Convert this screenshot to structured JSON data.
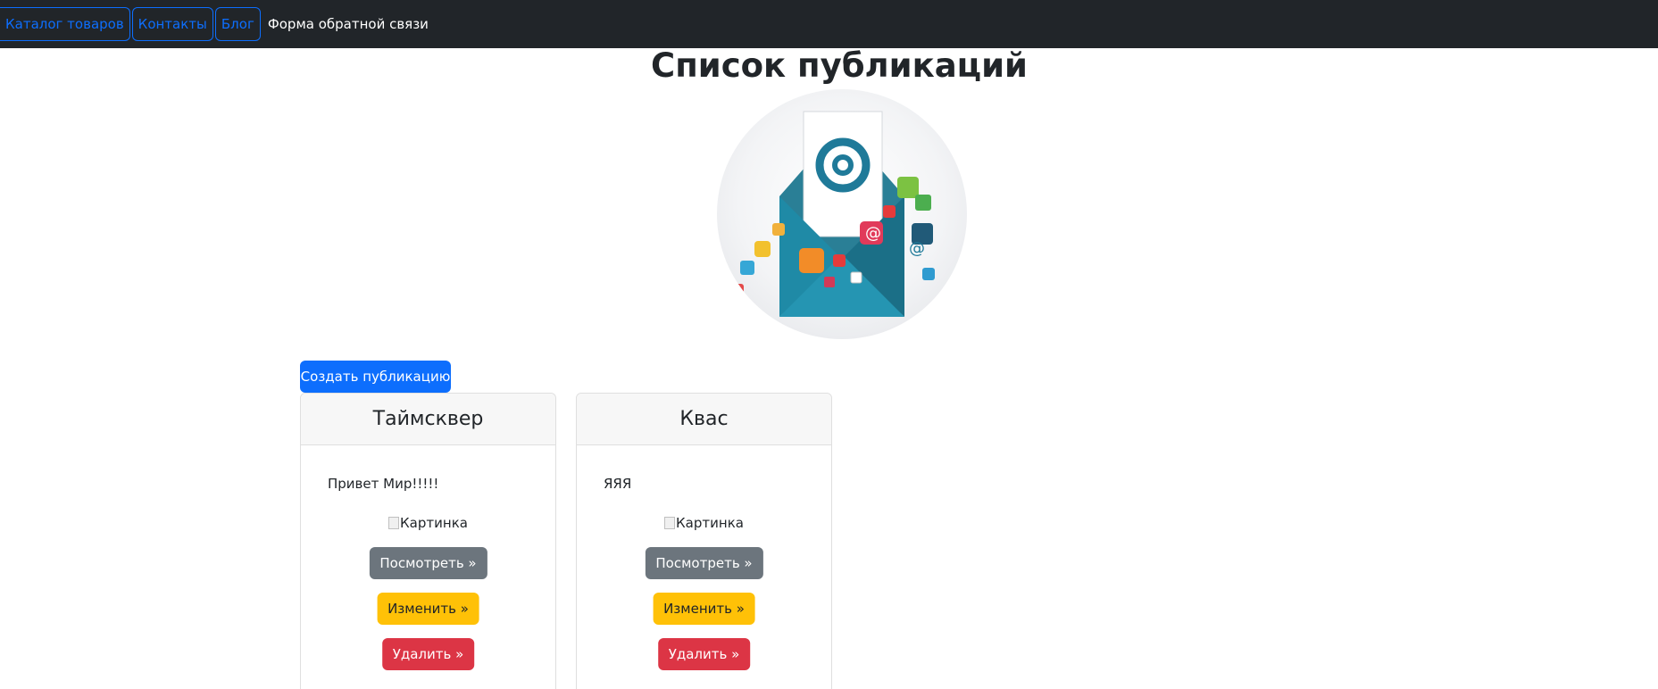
{
  "nav": {
    "items": [
      {
        "label": "Каталог товаров"
      },
      {
        "label": "Контакты"
      },
      {
        "label": "Блог"
      }
    ],
    "feedback_label": "Форма обратной связи"
  },
  "page": {
    "title": "Список публикаций",
    "create_button": "Создать публикацию"
  },
  "hero": {
    "icon": "email-envelope-illustration",
    "glyph": "@"
  },
  "posts": [
    {
      "title": "Таймсквер",
      "body": "Привет Мир!!!!!",
      "image_alt": "Картинка",
      "view_label": "Посмотреть »",
      "edit_label": "Изменить »",
      "delete_label": "Удалить »"
    },
    {
      "title": "Квас",
      "body": "ЯЯЯ",
      "image_alt": "Картинка",
      "view_label": "Посмотреть »",
      "edit_label": "Изменить »",
      "delete_label": "Удалить »"
    }
  ],
  "colors": {
    "navbar": "#212529",
    "primary": "#0d6efd",
    "secondary": "#6c757d",
    "warning": "#ffc107",
    "danger": "#dc3545",
    "envelope": "#1f8aa6"
  }
}
